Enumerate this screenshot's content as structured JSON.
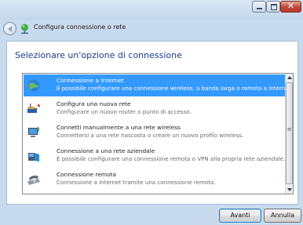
{
  "window": {
    "title": "Configura connessione o rete",
    "controls": {
      "minimize": "minimize",
      "maximize": "maximize",
      "close": "x"
    }
  },
  "heading": "Selezionare un'opzione di connessione",
  "options": [
    {
      "title": "Connessione a Internet",
      "desc": "È possibile configurare una connessione wireless, a banda larga o remota a Internet.",
      "icon": "globe-network-icon",
      "selected": true
    },
    {
      "title": "Configura una nuova rete",
      "desc": "Configurare un nuovo router o punto di accesso.",
      "icon": "router-icon",
      "selected": false
    },
    {
      "title": "Connetti manualmente a una rete wireless",
      "desc": "Connettersi a una rete nascosta o creare un nuovo profilo wireless.",
      "icon": "wireless-computer-icon",
      "selected": false
    },
    {
      "title": "Connessione a una rete aziendale",
      "desc": "È possibile configurare una connessione remota o VPN alla propria rete aziendale.",
      "icon": "workplace-network-icon",
      "selected": false
    },
    {
      "title": "Connessione remota",
      "desc": "Connessione a Internet tramite una connessione remota.",
      "icon": "dialup-phone-icon",
      "selected": false
    }
  ],
  "buttons": {
    "next": "Avanti",
    "cancel": "Annulla"
  },
  "colors": {
    "selection": "#3399ff",
    "heading": "#1e3a8a",
    "frame": "#c8dbee"
  }
}
